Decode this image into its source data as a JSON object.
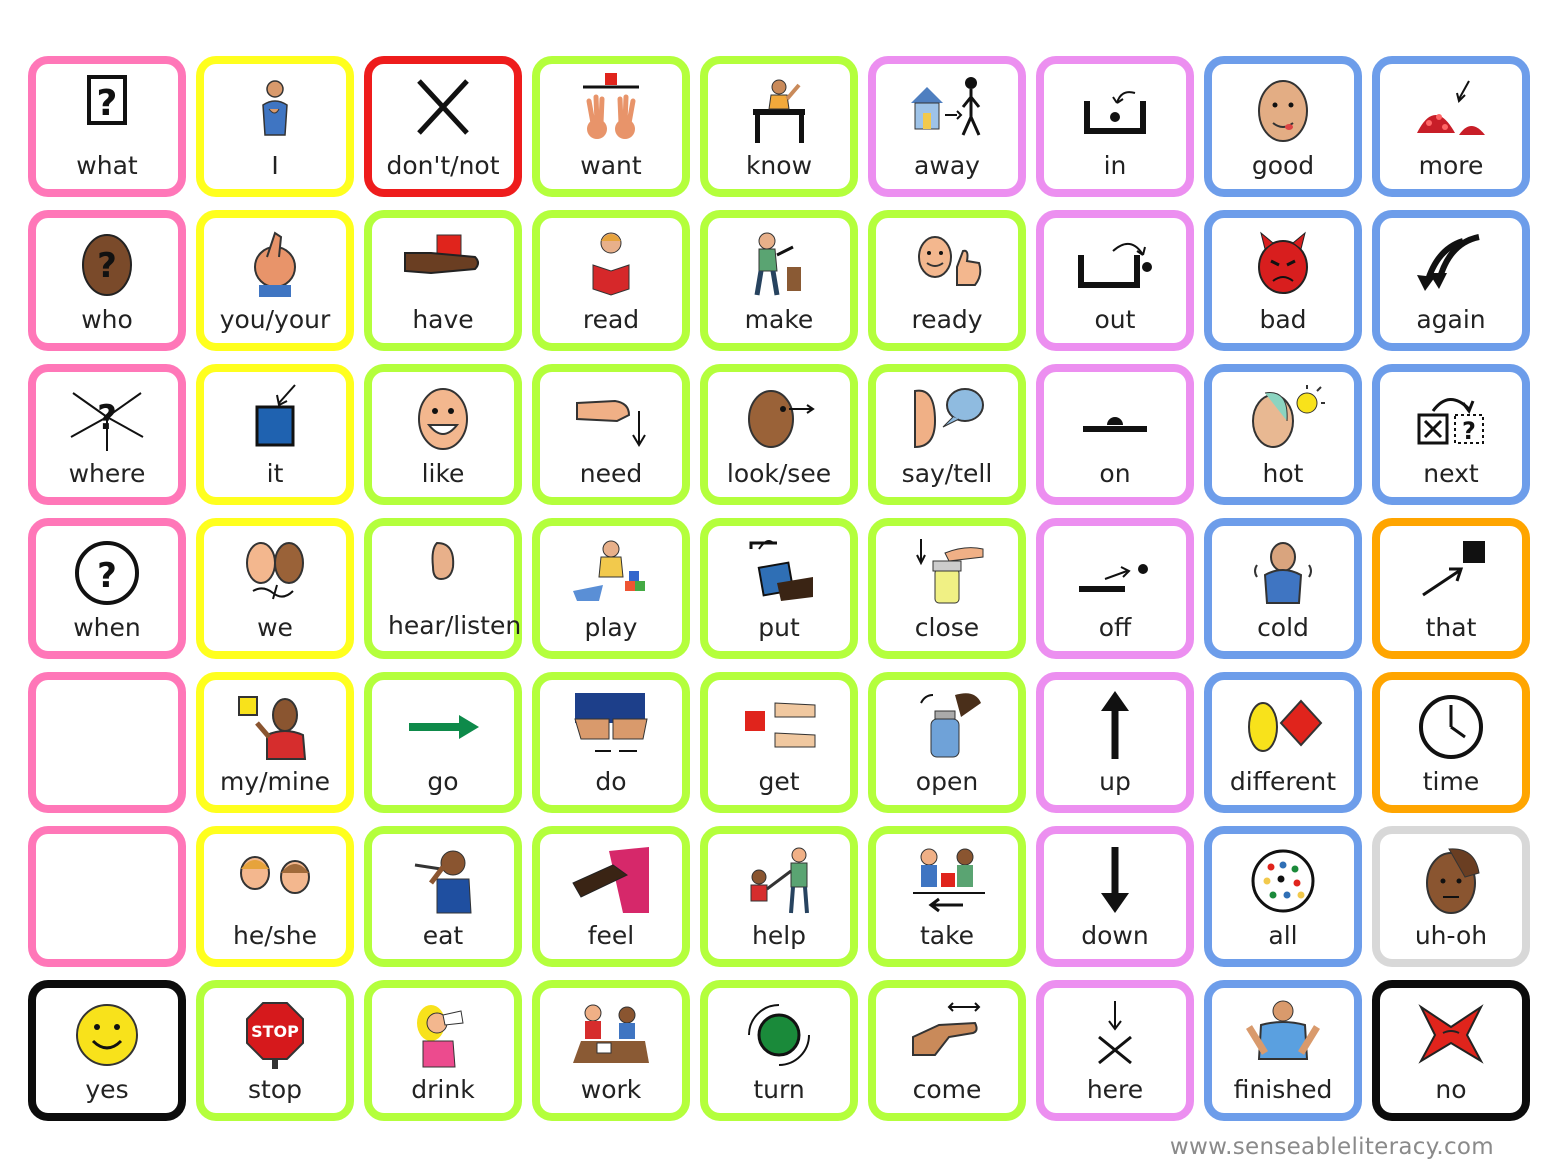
{
  "colors": {
    "pink": "#ff77b8",
    "yellow": "#ffff1e",
    "red": "#ee1c1c",
    "green": "#b4ff3c",
    "violet": "#ec8ff0",
    "blue": "#6d9dea",
    "orange": "#ffa500",
    "gray": "#d8d8d8",
    "black": "#0c0c0c"
  },
  "cells": [
    {
      "label": "what",
      "color": "pink",
      "icon": "question-box-icon"
    },
    {
      "label": "I",
      "color": "yellow",
      "icon": "person-self-icon"
    },
    {
      "label": "don't/not",
      "color": "red",
      "icon": "cross-x-icon"
    },
    {
      "label": "want",
      "color": "green",
      "icon": "want-hands-icon"
    },
    {
      "label": "know",
      "color": "green",
      "icon": "person-at-desk-icon"
    },
    {
      "label": "away",
      "color": "violet",
      "icon": "walk-away-house-icon"
    },
    {
      "label": "in",
      "color": "violet",
      "icon": "in-box-icon"
    },
    {
      "label": "good",
      "color": "blue",
      "icon": "good-face-icon"
    },
    {
      "label": "more",
      "color": "blue",
      "icon": "more-pile-icon"
    },
    {
      "label": "who",
      "color": "pink",
      "icon": "who-head-icon"
    },
    {
      "label": "you/your",
      "color": "yellow",
      "icon": "pointing-finger-icon"
    },
    {
      "label": "have",
      "color": "green",
      "icon": "hand-holding-square-icon"
    },
    {
      "label": "read",
      "color": "green",
      "icon": "reading-book-icon"
    },
    {
      "label": "make",
      "color": "green",
      "icon": "hammer-person-icon"
    },
    {
      "label": "ready",
      "color": "green",
      "icon": "thumbs-up-face-icon"
    },
    {
      "label": "out",
      "color": "violet",
      "icon": "out-box-icon"
    },
    {
      "label": "bad",
      "color": "blue",
      "icon": "devil-face-icon"
    },
    {
      "label": "again",
      "color": "blue",
      "icon": "again-arrows-icon"
    },
    {
      "label": "where",
      "color": "pink",
      "icon": "where-arrows-icon"
    },
    {
      "label": "it",
      "color": "yellow",
      "icon": "blue-square-arrow-icon"
    },
    {
      "label": "like",
      "color": "green",
      "icon": "smiling-face-icon"
    },
    {
      "label": "need",
      "color": "green",
      "icon": "pointing-down-hand-icon"
    },
    {
      "label": "look/see",
      "color": "green",
      "icon": "look-face-icon"
    },
    {
      "label": "say/tell",
      "color": "green",
      "icon": "speech-bubble-icon"
    },
    {
      "label": "on",
      "color": "violet",
      "icon": "on-line-icon"
    },
    {
      "label": "hot",
      "color": "blue",
      "icon": "hot-sun-icon"
    },
    {
      "label": "next",
      "color": "blue",
      "icon": "next-boxes-icon"
    },
    {
      "label": "when",
      "color": "pink",
      "icon": "clock-question-icon"
    },
    {
      "label": "we",
      "color": "yellow",
      "icon": "two-faces-icon"
    },
    {
      "label": "hear/listen",
      "color": "green",
      "icon": "ear-icon"
    },
    {
      "label": "play",
      "color": "green",
      "icon": "playing-blocks-icon"
    },
    {
      "label": "put",
      "color": "green",
      "icon": "put-box-hand-icon"
    },
    {
      "label": "close",
      "color": "green",
      "icon": "close-jar-icon"
    },
    {
      "label": "off",
      "color": "violet",
      "icon": "off-line-icon"
    },
    {
      "label": "cold",
      "color": "blue",
      "icon": "shivering-person-icon"
    },
    {
      "label": "that",
      "color": "orange",
      "icon": "arrow-square-icon"
    },
    {
      "label": "",
      "color": "pink",
      "icon": ""
    },
    {
      "label": "my/mine",
      "color": "yellow",
      "icon": "person-yellow-square-icon"
    },
    {
      "label": "go",
      "color": "green",
      "icon": "green-arrow-right-icon"
    },
    {
      "label": "do",
      "color": "green",
      "icon": "do-hands-icon"
    },
    {
      "label": "get",
      "color": "green",
      "icon": "get-hands-square-icon"
    },
    {
      "label": "open",
      "color": "green",
      "icon": "open-jar-icon"
    },
    {
      "label": "up",
      "color": "violet",
      "icon": "arrow-up-icon"
    },
    {
      "label": "different",
      "color": "blue",
      "icon": "different-shapes-icon"
    },
    {
      "label": "time",
      "color": "orange",
      "icon": "clock-icon"
    },
    {
      "label": "",
      "color": "pink",
      "icon": ""
    },
    {
      "label": "he/she",
      "color": "yellow",
      "icon": "boy-girl-faces-icon"
    },
    {
      "label": "eat",
      "color": "green",
      "icon": "eating-person-icon"
    },
    {
      "label": "feel",
      "color": "green",
      "icon": "feel-hand-cloth-icon"
    },
    {
      "label": "help",
      "color": "green",
      "icon": "helping-people-icon"
    },
    {
      "label": "take",
      "color": "green",
      "icon": "take-people-icon"
    },
    {
      "label": "down",
      "color": "violet",
      "icon": "arrow-down-icon"
    },
    {
      "label": "all",
      "color": "blue",
      "icon": "all-dots-circle-icon"
    },
    {
      "label": "uh-oh",
      "color": "gray",
      "icon": "uh-oh-face-icon"
    },
    {
      "label": "yes",
      "color": "black",
      "icon": "yellow-smiley-icon"
    },
    {
      "label": "stop",
      "color": "green",
      "icon": "stop-sign-icon"
    },
    {
      "label": "drink",
      "color": "green",
      "icon": "drinking-girl-icon"
    },
    {
      "label": "work",
      "color": "green",
      "icon": "working-kids-icon"
    },
    {
      "label": "turn",
      "color": "green",
      "icon": "turn-circle-icon"
    },
    {
      "label": "come",
      "color": "green",
      "icon": "come-hand-icon"
    },
    {
      "label": "here",
      "color": "violet",
      "icon": "here-arrow-x-icon"
    },
    {
      "label": "finished",
      "color": "blue",
      "icon": "finished-person-icon"
    },
    {
      "label": "no",
      "color": "black",
      "icon": "red-x-icon"
    }
  ],
  "footer": "www.senseableliteracy.com"
}
